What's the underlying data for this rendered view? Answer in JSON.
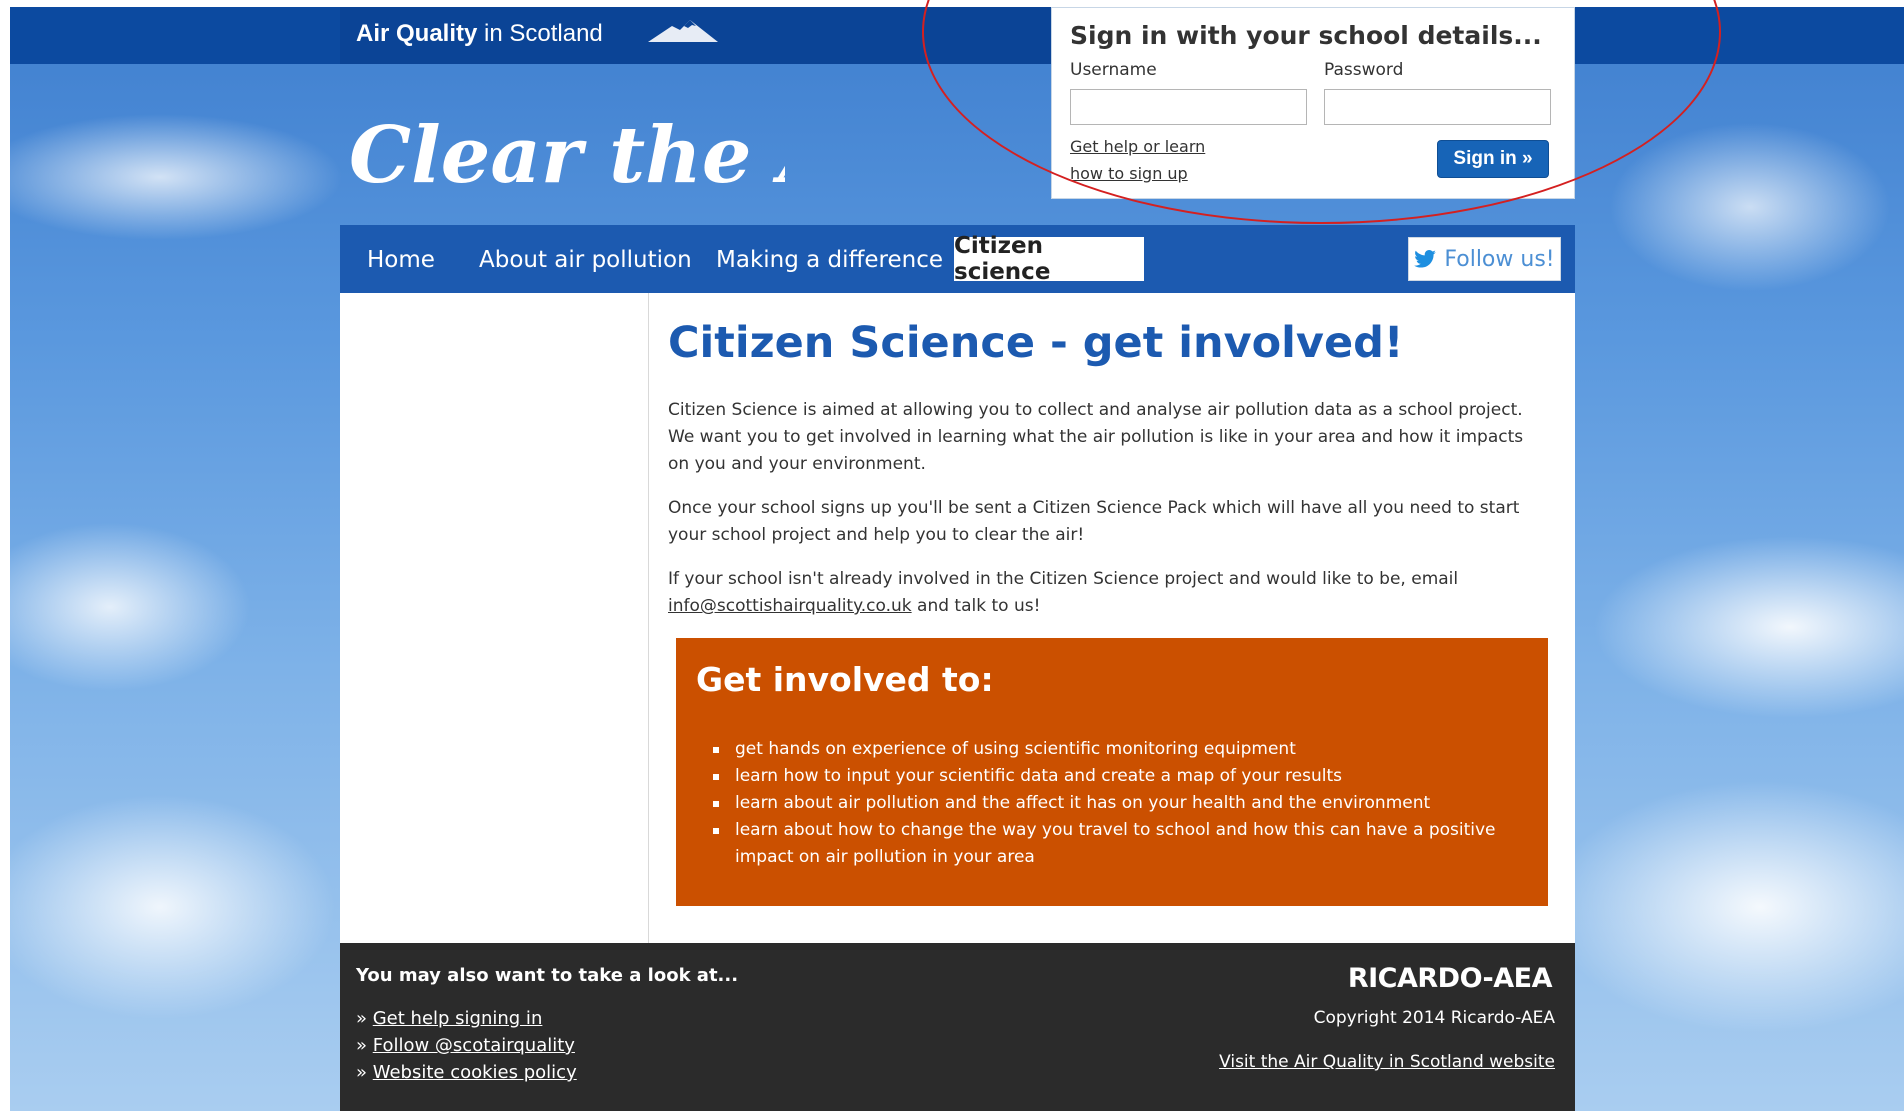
{
  "header": {
    "brand_bold": "Air Quality",
    "brand_rest": " in Scotland",
    "logo_text": "Clear the Air"
  },
  "signin": {
    "title": "Sign in with your school details...",
    "username_label": "Username",
    "password_label": "Password",
    "help_line1": "Get help or learn",
    "help_line2": "how to sign up",
    "button_label": "Sign in »"
  },
  "nav": {
    "items": [
      "Home",
      "About air pollution",
      "Making a difference",
      "Citizen science"
    ],
    "active_index": 3,
    "follow_label": "Follow us!"
  },
  "main": {
    "title": "Citizen Science - get involved!",
    "para1": "Citizen Science is aimed at allowing you to collect and analyse air pollution data as a school project. We want you to get involved in learning what the air pollution is like in your area and how it impacts on you and your environment.",
    "para2": "Once your school signs up you'll be sent a Citizen Science Pack which will have all you need to start your school project and help you to clear the air!",
    "para3_before": "If your school isn't already involved in the Citizen Science project and would like to be, email ",
    "para3_email": "info@scottishairquality.co.uk",
    "para3_after": " and talk to us!",
    "box_title": "Get involved to:",
    "box_items": [
      "get hands on experience of using scientific monitoring equipment",
      "learn how to input your scientific data and create a map of your results",
      "learn about air pollution and the affect it has on your health and the environment",
      "learn about how to change the way you travel to school and how this can have a positive impact on air pollution in your area"
    ]
  },
  "footer": {
    "heading": "You may also want to take a look at...",
    "links": [
      "Get help signing in",
      "Follow @scotairquality",
      "Website cookies policy"
    ],
    "company": "RICARDO-AEA",
    "copyright": "Copyright 2014 Ricardo-AEA",
    "visit_link": "Visit the Air Quality in Scotland website"
  },
  "colors": {
    "brand_blue": "#0c4aa0",
    "nav_blue": "#1c5ab0",
    "accent_orange": "#cb5000",
    "footer_dark": "#2b2b2b",
    "annotation_red": "#d42020"
  },
  "icons": {
    "mountain": "mountain-icon",
    "twitter": "twitter-bird-icon"
  }
}
